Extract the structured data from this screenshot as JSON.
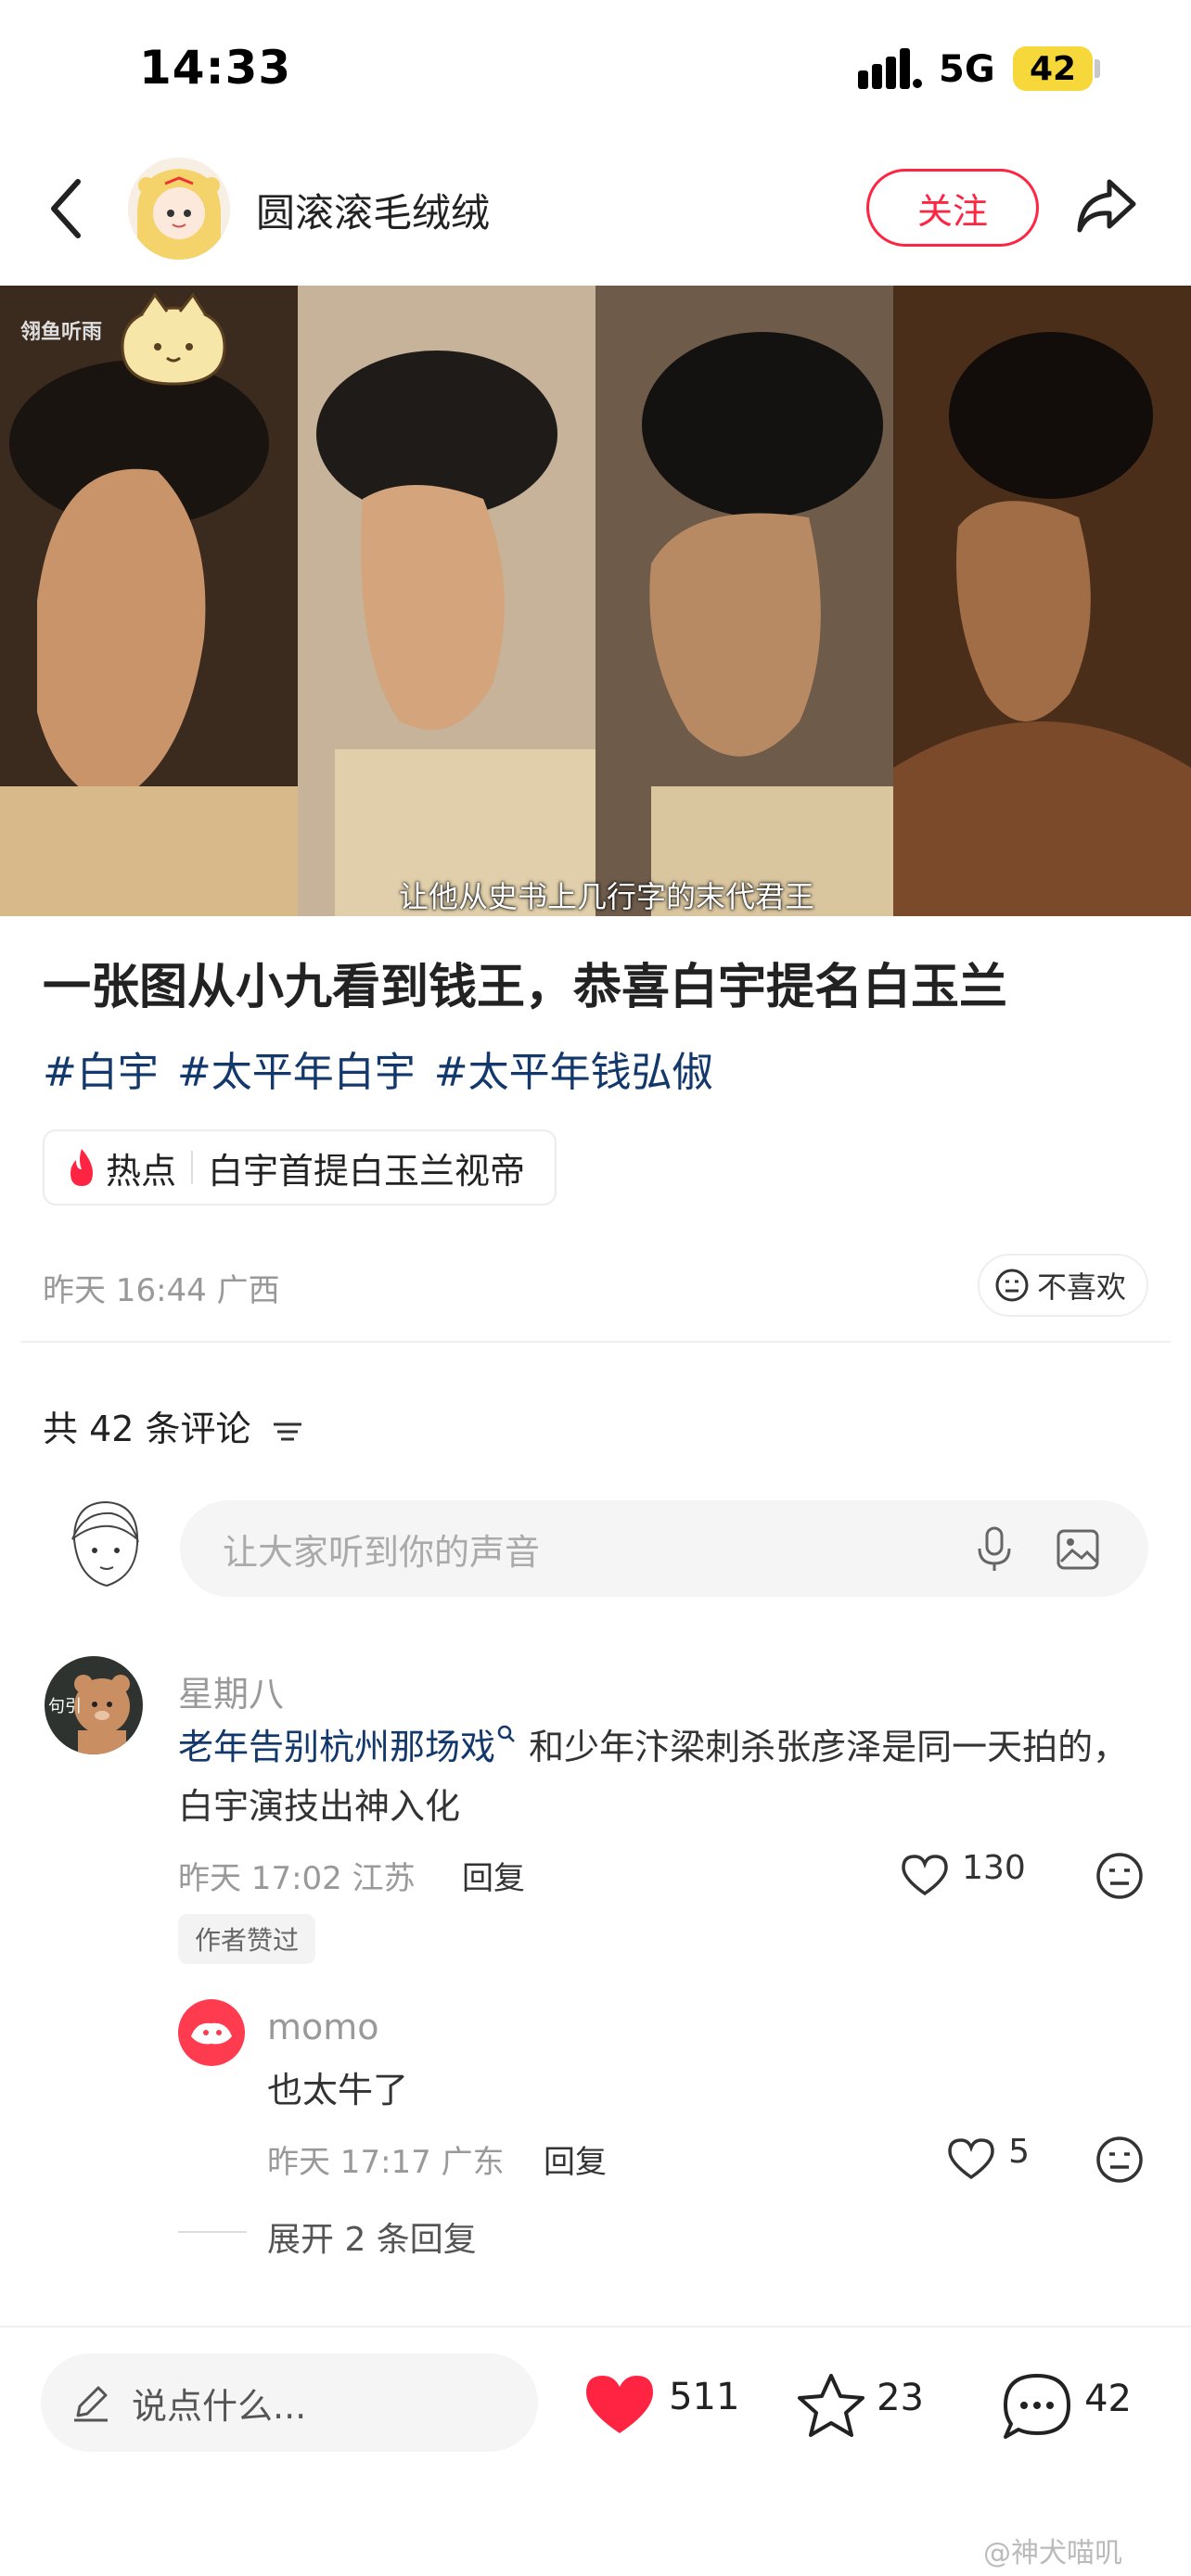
{
  "status": {
    "time": "14:33",
    "network": "5G",
    "battery": "42"
  },
  "header": {
    "author": "圆滚滚毛绒绒",
    "follow_label": "关注"
  },
  "photo": {
    "watermark": "翎鱼听雨",
    "caption": "让他从史书上几行字的末代君王"
  },
  "post": {
    "title": "一张图从小九看到钱王，恭喜白宇提名白玉兰",
    "tags": [
      "#白宇",
      "#太平年白宇",
      "#太平年钱弘俶"
    ],
    "hot_label": "热点",
    "hot_text": "白宇首提白玉兰视帝",
    "meta": "昨天 16:44 广西",
    "dislike_label": "不喜欢"
  },
  "comments_section": {
    "count_label": "共 42 条评论",
    "input_placeholder": "让大家听到你的声音",
    "comments": [
      {
        "name": "星期八",
        "avatar_text": "句引",
        "link_text": "老年告别杭州那场戏",
        "text_rest": " 和少年汴梁刺杀张彦泽是同一天拍的，白宇演技出神入化",
        "text_line2": "的，白宇演技出神入化",
        "meta": "昨天 17:02 江苏",
        "reply_label": "回复",
        "likes": "130",
        "badge": "作者赞过"
      },
      {
        "name": "momo",
        "text": "也太牛了",
        "meta": "昨天 17:17 广东",
        "reply_label": "回复",
        "likes": "5"
      }
    ],
    "expand_label": "展开 2 条回复"
  },
  "bottom_bar": {
    "placeholder": "说点什么...",
    "likes": "511",
    "stars": "23",
    "comments": "42"
  },
  "footer_watermark": "@神犬喵叽",
  "colors": {
    "accent": "#ff2442",
    "tag": "#13386c",
    "link": "#13386c"
  }
}
